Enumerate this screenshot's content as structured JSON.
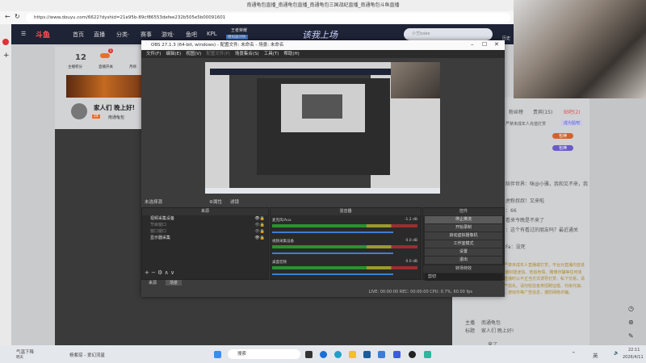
{
  "browser": {
    "title": "南通龟包直播_南通龟包直播_南通龟包三国战纪直播_南通龟包斗鱼直播",
    "url": "https://www.douyu.com/6622?dyshid=21e95b-89cf86553defee232b505e5b00091601"
  },
  "douyu": {
    "logo": "斗鱼",
    "nav": [
      "首页",
      "直播",
      "分类·",
      "赛事",
      "游戏·",
      "鱼吧",
      "KPL"
    ],
    "promo": "王者荣耀",
    "promo_sub": "模拟器对抗",
    "banner_text": "该我上场",
    "search_placeholder": "小艺babe",
    "history": "历史",
    "card": {
      "score": "12",
      "score_label": "主播积分",
      "live_label": "直播开关",
      "month_label": "月榜",
      "badge": "1",
      "room_title": "家人们 晚上好!",
      "anchor": "南通龟包",
      "level": "24"
    }
  },
  "chat": {
    "tabs": [
      "粉丝榜",
      "贵宾(15)",
      "贴吧(2)"
    ],
    "notice": "严禁未成年人充值打赏",
    "fan_btn": "成为贴吧",
    "badges": [
      "包神",
      "包神"
    ],
    "lines": [
      "陪伴世界：咪@小雅，我和又不来，我",
      "虎粉叔叔！又来啦",
      "：66",
      "看来今晚是不来了",
      "：这个有看过的朋友吗？最近通关",
      "Fa：没死"
    ],
    "system": "欢迎来到直播间。斗鱼严禁未成年人直播或打赏，平台对直播内容进行24小时巡查。禁止传播封建迷信、低俗色情、赌博诈骗等任何违法违规内容。若主播在直播时以不正当方式诱导打赏、私下交易，请谨慎判断，以防人身财产损失。请勿轻信各类招聘征婚、代练代抽、私下交易、购买礼包码、游戏币等广告信息，谨防网络诈骗。",
    "host_label": "主播",
    "host": "南通龟包",
    "title_label": "标题",
    "title": "家人们 晚上好!",
    "last": "来了"
  },
  "obs": {
    "title": "OBS 27.1.3 (64-bit, windows) - 配置文件: 未命名 - 场景: 未命名",
    "menu": [
      "文件(F)",
      "编辑(E)",
      "视图(V)",
      "配置文件(P)",
      "场景集合(S)",
      "工具(T)",
      "帮助(H)"
    ],
    "no_source": "未选择源",
    "props": "属性",
    "filters": "滤镜",
    "sources_title": "来源",
    "sources": [
      "视频采集设备",
      "节目窗口",
      "窗口窗口",
      "显示器采集"
    ],
    "mixer_title": "混音器",
    "mixer": [
      {
        "name": "麦克风/Aux",
        "db": "-1.2 dB"
      },
      {
        "name": "视频采集设备",
        "db": "0.0 dB"
      },
      {
        "name": "桌面音频",
        "db": "0.0 dB"
      }
    ],
    "controls_title": "控件",
    "controls": [
      "停止推流",
      "开始录制",
      "启动虚拟摄像机",
      "工作室模式",
      "设置",
      "退出"
    ],
    "transition_title": "转场特效",
    "transition": "剪切",
    "tabs": [
      "来源",
      "场景"
    ],
    "status": "LIVE: 00:00:00   REC: 00:00:00   CPU: 0.7%, 60.00 fps"
  },
  "taskbar": {
    "weather": "气温下降",
    "weather_sub": "明天",
    "media": "杨紫琼 - 爱幻流星",
    "search": "搜索",
    "ime": "英",
    "time": "22:11",
    "date": "2026/4/11"
  }
}
